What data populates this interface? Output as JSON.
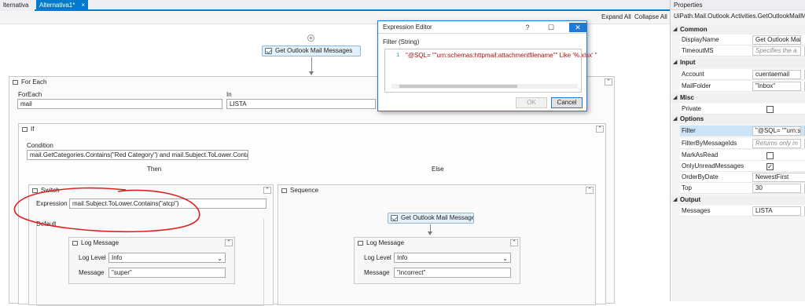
{
  "tabs": [
    {
      "label": "lternativa"
    },
    {
      "label": "Alternativa1*",
      "close": "×"
    }
  ],
  "toolbar": {
    "expand_all": "Expand All",
    "collapse_all": "Collapse All"
  },
  "designer": {
    "get_outlook_top": "Get Outlook Mail Messages",
    "foreach": {
      "title": "For Each",
      "foreach_label": "ForEach",
      "in_label": "In",
      "item": "mail",
      "collection": "LISTA"
    },
    "if_block": {
      "title": "If",
      "condition_label": "Condition",
      "condition": "mail.GetCategories.Contains(\"Red Category\") and mail.Subject.ToLower.Contains(\"t",
      "then_label": "Then",
      "else_label": "Else"
    },
    "switch_block": {
      "title": "Switch",
      "expression_label": "Expression",
      "expression": "mail.Subject.ToLower.Contains(\"atcp\")",
      "default_label": "Default",
      "log": {
        "title": "Log Message",
        "level_label": "Log Level",
        "level": "Info",
        "message_label": "Message",
        "message": "\"super\""
      }
    },
    "sequence_block": {
      "title": "Sequence",
      "get_outlook": "Get Outlook Mail Messages",
      "log": {
        "title": "Log Message",
        "level_label": "Log Level",
        "level": "Info",
        "message_label": "Message",
        "message": "\"incorrect\""
      }
    }
  },
  "dialog": {
    "title": "Expression Editor",
    "help": "?",
    "maximize": "☐",
    "close": "✕",
    "filter_label": "Filter (String)",
    "line_no": "1",
    "code": "\"@SQL= \"\"urn:schemas:httpmail:attachmentfilename\"\" Like '%.xlsx' \"",
    "ok": "OK",
    "cancel": "Cancel"
  },
  "properties": {
    "title": "Properties",
    "subtitle": "UiPath.Mail.Outlook.Activities.GetOutlookMailMessages",
    "categories": [
      {
        "name": "Common",
        "rows": [
          {
            "name": "DisplayName",
            "value": "Get Outlook Mail Messages",
            "placeholder": false
          },
          {
            "name": "TimeoutMS",
            "value": "Specifies the a",
            "placeholder": true
          }
        ]
      },
      {
        "name": "Input",
        "rows": [
          {
            "name": "Account",
            "value": "cuentaemail",
            "placeholder": false
          },
          {
            "name": "MailFolder",
            "value": "\"Inbox\"",
            "placeholder": false
          }
        ]
      },
      {
        "name": "Misc",
        "rows": [
          {
            "name": "Private",
            "checked": false
          }
        ]
      },
      {
        "name": "Options",
        "rows": [
          {
            "name": "Filter",
            "value": "\"@SQL= \"\"urn:sch",
            "placeholder": false,
            "selected": true
          },
          {
            "name": "FilterByMessageIds",
            "value": "Returns only m",
            "placeholder": true
          },
          {
            "name": "MarkAsRead",
            "checked": false
          },
          {
            "name": "OnlyUnreadMessages",
            "checked": true
          },
          {
            "name": "OrderByDate",
            "value": "NewestFirst",
            "dropdown": true
          },
          {
            "name": "Top",
            "value": "30",
            "placeholder": false
          }
        ]
      },
      {
        "name": "Output",
        "rows": [
          {
            "name": "Messages",
            "value": "LISTA",
            "placeholder": false
          }
        ]
      }
    ]
  },
  "annotation": {
    "color": "#e02020"
  }
}
